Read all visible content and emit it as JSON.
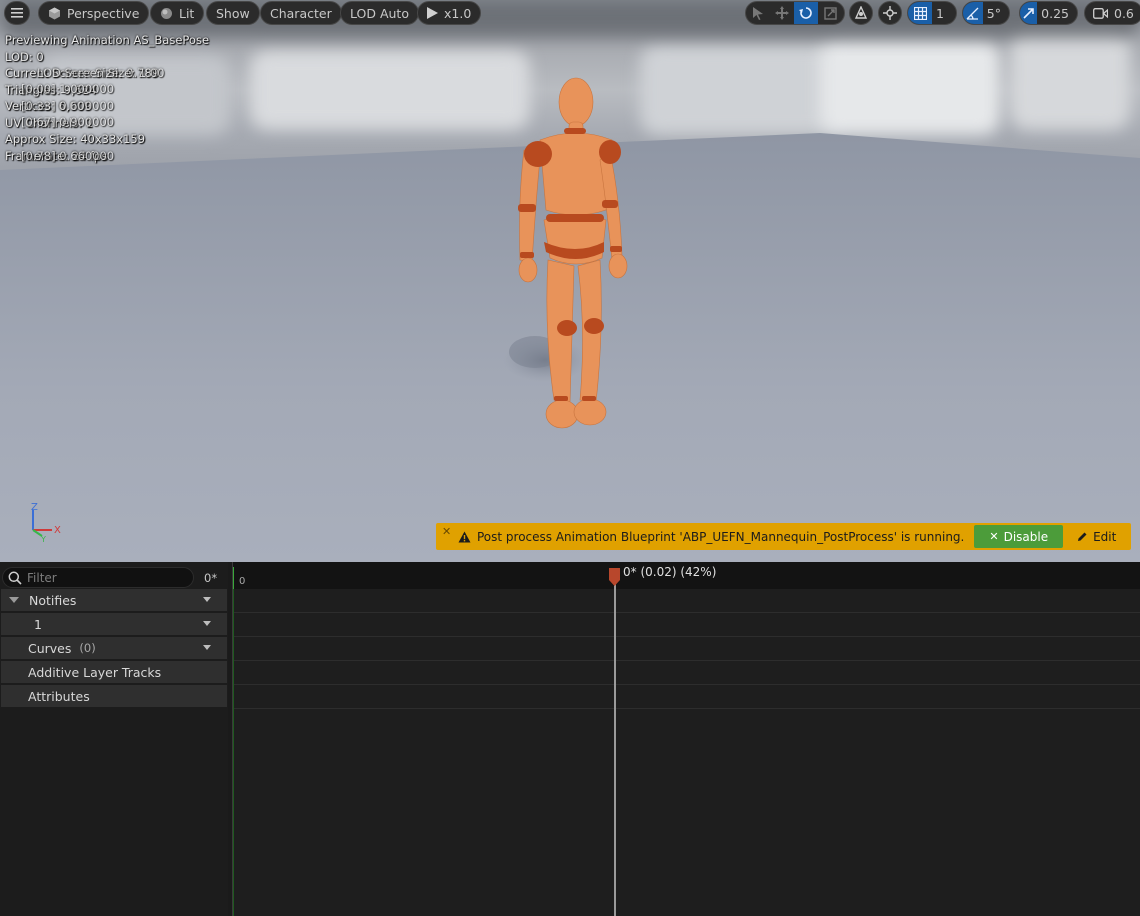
{
  "toolbar": {
    "menu_icon": "hamburger-icon",
    "perspective_label": "Perspective",
    "lit_label": "Lit",
    "show_label": "Show",
    "character_label": "Character",
    "lod_label": "LOD Auto",
    "play_rate_label": "x1.0",
    "grid_snap_value": "1",
    "angle_snap_value": "5°",
    "scale_snap_value": "0.25",
    "camera_speed_value": "0.6"
  },
  "stats": {
    "line1": "Previewing Animation AS_BasePose",
    "line2": "LOD: 0",
    "line3": "Current Screen Size: 0.789",
    "line4": "Triangles: 9,624",
    "line5": "Vertices: 6,009",
    "line6": "UV Channels: 1",
    "line7": "Approx Size: 40x33x159",
    "line8": "Framerate: 24 fps",
    "ghost1": "LOD Screen Size: 1.00",
    "ghost2": "[0.00] 1.000000",
    "ghost3": "[0.33] 0.600000",
    "ghost4": "[0.67] 0.900000",
    "ghost5": "[0.78] 0.660000"
  },
  "axis": {
    "z": "Z",
    "x": "X",
    "y": "Y"
  },
  "notice": {
    "close": "✕",
    "message": "Post process Animation Blueprint 'ABP_UEFN_Mannequin_PostProcess' is running.",
    "disable_label": "Disable",
    "edit_label": "Edit",
    "color": "#e0a100"
  },
  "tracks": {
    "filter_placeholder": "Filter",
    "frame_label": "0*",
    "notifies_label": "Notifies",
    "notify_track_label": "1",
    "curves_label": "Curves",
    "curves_count": "(0)",
    "additive_label": "Additive Layer Tracks",
    "attributes_label": "Attributes"
  },
  "timeline": {
    "ruler_start": "0",
    "playhead_label": "0* (0.02) (42%)"
  }
}
